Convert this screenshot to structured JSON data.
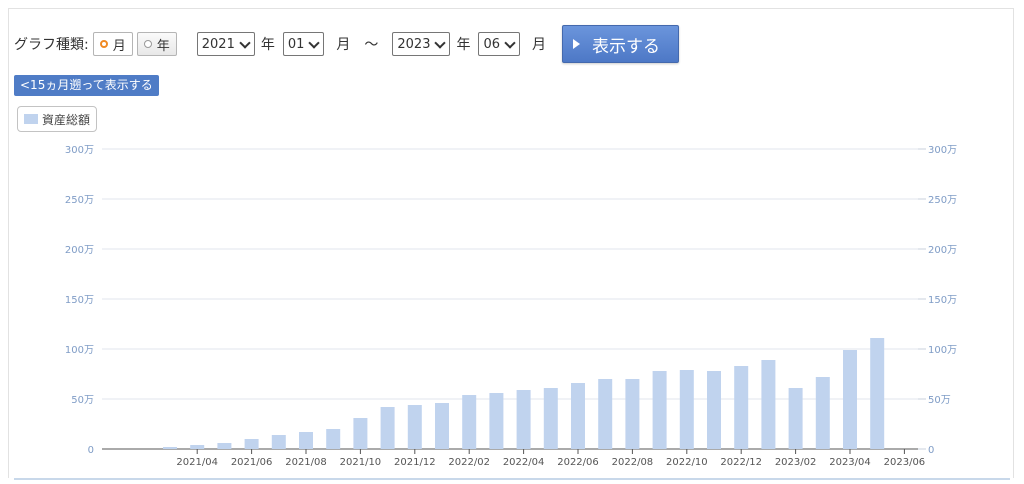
{
  "controls": {
    "graph_type_label": "グラフ種類:",
    "radio_month": "月",
    "radio_year": "年",
    "selected_type": "月",
    "from_year": "2021",
    "from_year_unit": "年",
    "from_month": "01",
    "from_month_unit": "月",
    "range_separator": "～",
    "to_year": "2023",
    "to_year_unit": "年",
    "to_month": "06",
    "to_month_unit": "月",
    "show_button": "表示する",
    "back_button": "<15ヵ月遡って表示する"
  },
  "legend": {
    "label": "資産総額",
    "color": "#c0d3ee"
  },
  "chart_data": {
    "type": "bar",
    "series": [
      {
        "name": "資産総額",
        "color": "#c0d3ee",
        "values": [
          0,
          0,
          2,
          4,
          6,
          10,
          14,
          17,
          20,
          31,
          42,
          44,
          46,
          54,
          56,
          59,
          61,
          66,
          70,
          70,
          78,
          79,
          78,
          83,
          89,
          61,
          72,
          99,
          111
        ]
      }
    ],
    "x": [
      "2021/01",
      "2021/02",
      "2021/03",
      "2021/04",
      "2021/05",
      "2021/06",
      "2021/07",
      "2021/08",
      "2021/09",
      "2021/10",
      "2021/11",
      "2021/12",
      "2022/01",
      "2022/02",
      "2022/03",
      "2022/04",
      "2022/05",
      "2022/06",
      "2022/07",
      "2022/08",
      "2022/09",
      "2022/10",
      "2022/11",
      "2022/12",
      "2023/01",
      "2023/02",
      "2023/03",
      "2023/04",
      "2023/05",
      "2023/06"
    ],
    "x_tick_labels": [
      "2021/04",
      "2021/06",
      "2021/08",
      "2021/10",
      "2021/12",
      "2022/02",
      "2022/04",
      "2022/06",
      "2022/08",
      "2022/10",
      "2022/12",
      "2023/02",
      "2023/04",
      "2023/06"
    ],
    "y_tick_labels": [
      "0",
      "50万",
      "100万",
      "150万",
      "200万",
      "250万",
      "300万"
    ],
    "ylim": [
      0,
      300
    ],
    "y_unit": "万",
    "grid": true,
    "dual_y_axis": true
  }
}
